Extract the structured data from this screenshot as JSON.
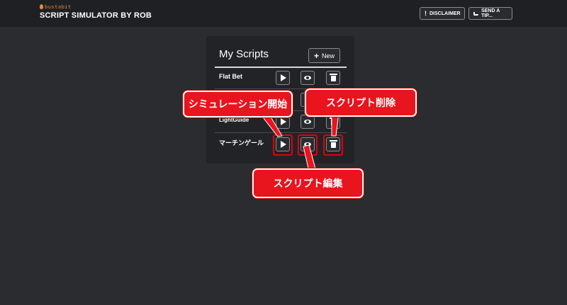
{
  "header": {
    "brand": "bustabit",
    "title": "SCRIPT SIMULATOR BY ROB",
    "disclaimer_label": "DISCLAIMER",
    "tip_label": "SEND A TIP..."
  },
  "panel": {
    "title": "My Scripts",
    "new_label": "New",
    "rows": [
      {
        "label": "Flat Bet"
      },
      {
        "label": ""
      },
      {
        "label": "LightGuide"
      },
      {
        "label": "マーチンゲール"
      }
    ]
  },
  "callouts": {
    "start": "シミュレーション開始",
    "delete": "スクリプト削除",
    "edit": "スクリプト編集"
  },
  "colors": {
    "background": "#2b2c30",
    "header": "#1f2023",
    "panel": "#222326",
    "callout": "#e8141e",
    "highlight": "#e0000f",
    "brand": "#e8893a"
  },
  "icons": [
    "play-icon",
    "eye-icon",
    "trash-icon",
    "plus-icon",
    "exclamation-icon",
    "hand-icon",
    "flame-icon"
  ]
}
